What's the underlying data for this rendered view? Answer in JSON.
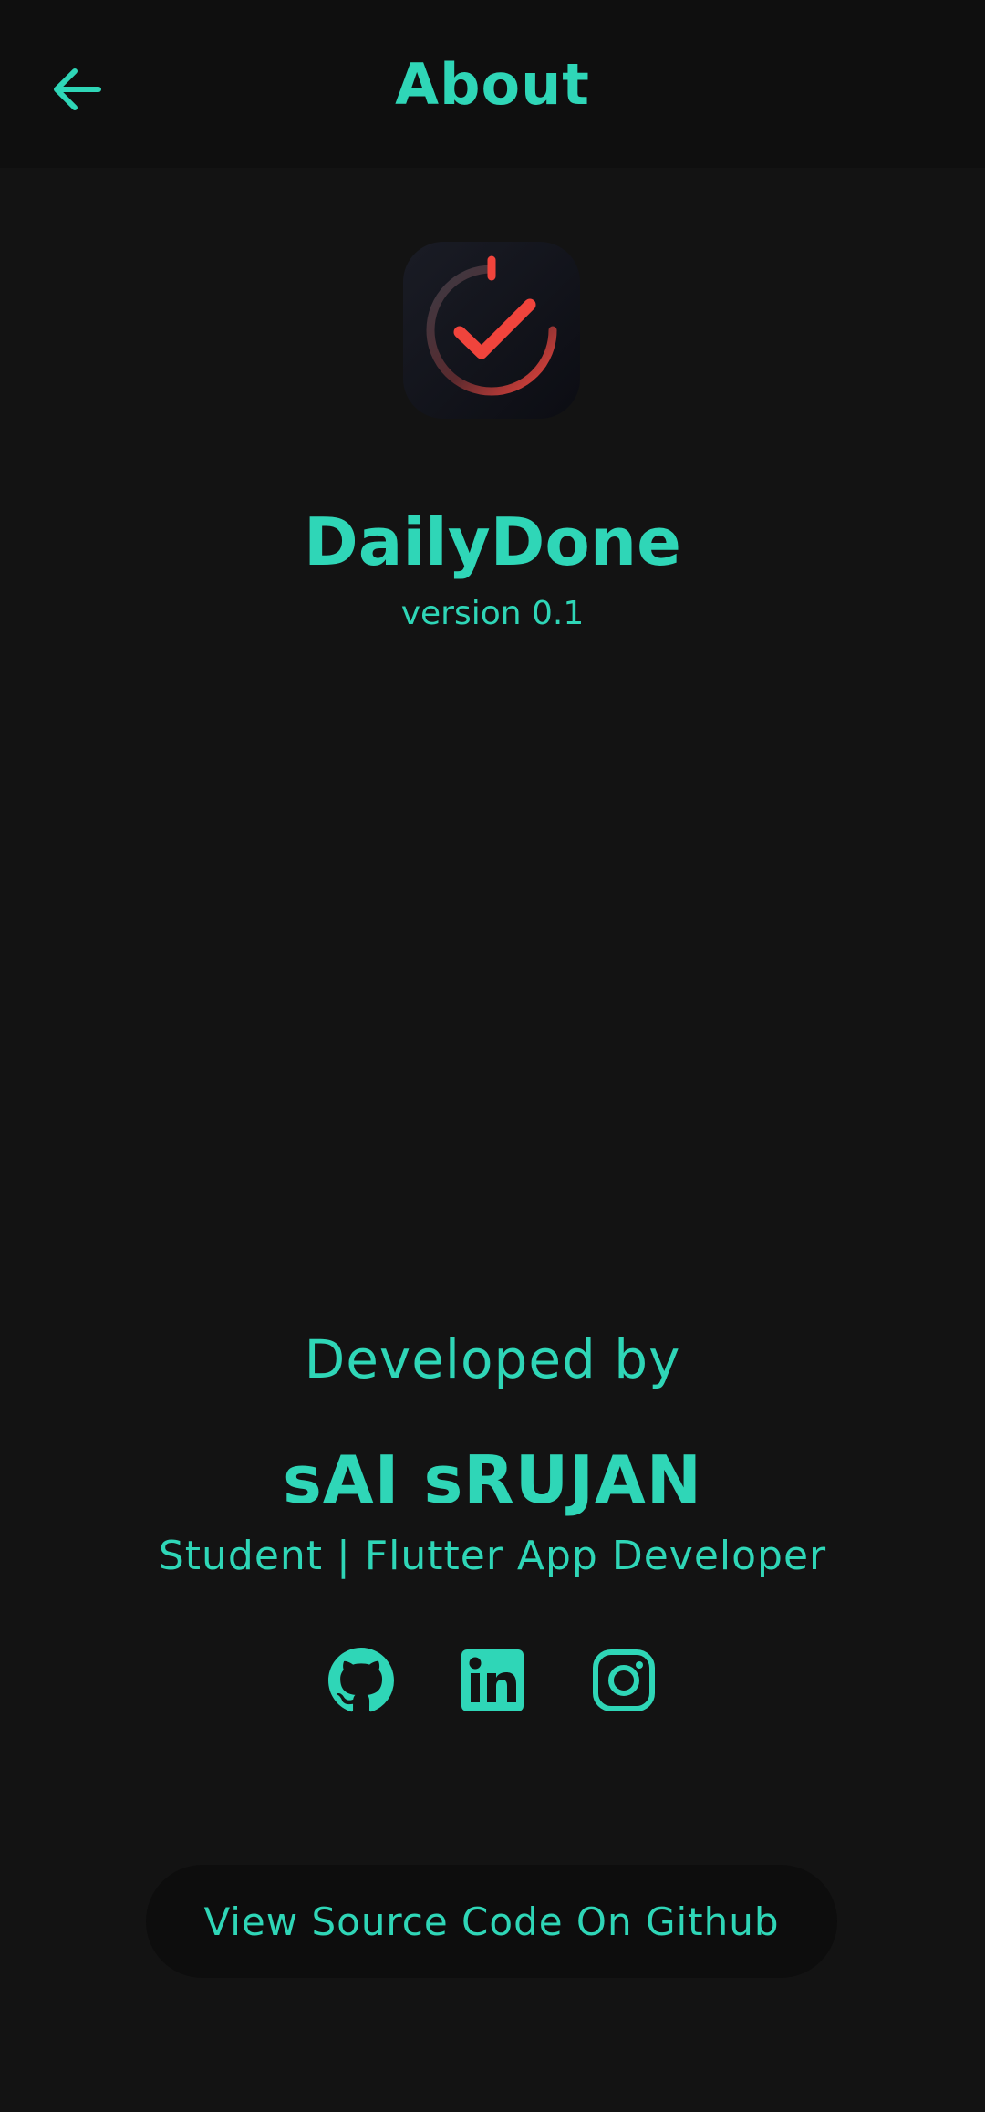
{
  "header": {
    "title": "About",
    "back_icon": "arrow-left-icon"
  },
  "app": {
    "logo_icon": "timer-check-icon",
    "name": "DailyDone",
    "version": "version 0.1"
  },
  "developer": {
    "heading": "Developed by",
    "name": "sAI sRUJAN",
    "role": "Student | Flutter App Developer",
    "socials": [
      {
        "icon": "github-icon"
      },
      {
        "icon": "linkedin-icon"
      },
      {
        "icon": "instagram-icon"
      }
    ]
  },
  "footer": {
    "source_button_label": "View Source Code On Github"
  },
  "colors": {
    "background": "#131313",
    "app_bar": "#0f0f0f",
    "accent": "#2fd6b7",
    "logo_red": "#f0443c",
    "button_bg": "#0d0d0d"
  }
}
